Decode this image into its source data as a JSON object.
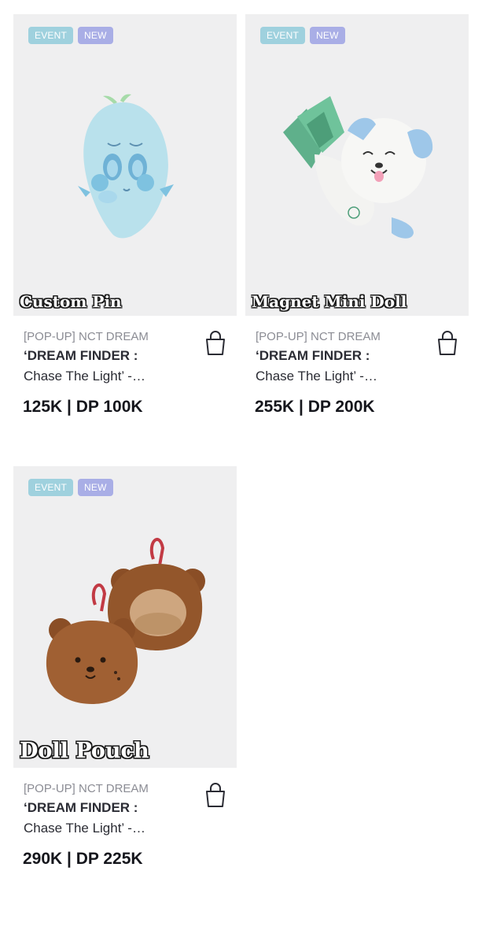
{
  "products": [
    {
      "badges": {
        "event": "EVENT",
        "new": "NEW"
      },
      "overlay_label": "Custom Pin",
      "brand": "[POP-UP] NCT DREAM",
      "title_line1": "‘DREAM FINDER :",
      "title_line2": "Chase The Light’ -…",
      "price": "125K | DP 100K",
      "cart_icon": "shopping-bag-icon"
    },
    {
      "badges": {
        "event": "EVENT",
        "new": "NEW"
      },
      "overlay_label": "Magnet Mini Doll",
      "brand": "[POP-UP] NCT DREAM",
      "title_line1": "‘DREAM FINDER :",
      "title_line2": "Chase The Light’ -…",
      "price": "255K | DP 200K",
      "cart_icon": "shopping-bag-icon"
    },
    {
      "badges": {
        "event": "EVENT",
        "new": "NEW"
      },
      "overlay_label": "Doll Pouch",
      "brand": "[POP-UP] NCT DREAM",
      "title_line1": "‘DREAM FINDER :",
      "title_line2": "Chase The Light’ -…",
      "price": "290K | DP 225K",
      "cart_icon": "shopping-bag-icon"
    }
  ],
  "colors": {
    "badge_event": "#9fd1de",
    "badge_new": "#a9aee6",
    "thumb_bg": "#efeff0",
    "brand_text": "#8b8c94",
    "price_text": "#15161c"
  }
}
